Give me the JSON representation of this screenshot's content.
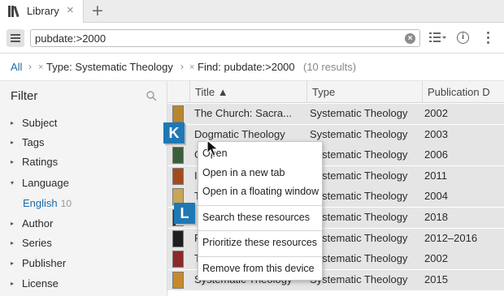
{
  "tab": {
    "label": "Library",
    "close_glyph": "×",
    "new_tab_glyph": "+"
  },
  "toolbar": {
    "search_value": "pubdate:>2000",
    "clear_icon": "clear-circle-icon",
    "view_icon": "list-view-icon",
    "info_icon": "info-icon",
    "more_icon": "more-vertical-icon"
  },
  "breadcrumb": {
    "all": "All",
    "sep": "›",
    "x": "×",
    "type_label": "Type: Systematic Theology",
    "find_label": "Find: pubdate:>2000",
    "result_count": "(10 results)"
  },
  "filter": {
    "header": "Filter",
    "items": [
      {
        "label": "Subject",
        "expanded": false
      },
      {
        "label": "Tags",
        "expanded": false
      },
      {
        "label": "Ratings",
        "expanded": false
      },
      {
        "label": "Language",
        "expanded": true
      },
      {
        "label": "Author",
        "expanded": false
      },
      {
        "label": "Series",
        "expanded": false
      },
      {
        "label": "Publisher",
        "expanded": false
      },
      {
        "label": "License",
        "expanded": false
      }
    ],
    "language_sub": {
      "label": "English",
      "count": "10"
    },
    "arrow_collapsed": "▸",
    "arrow_expanded": "▾"
  },
  "table": {
    "columns": [
      {
        "label": "Title ▲"
      },
      {
        "label": "Type"
      },
      {
        "label": "Publication D"
      }
    ],
    "rows": [
      {
        "title": "The Church: Sacra...",
        "type": "Systematic Theology",
        "date": "2002",
        "cover": "#b8862f"
      },
      {
        "title": "Dogmatic Theology",
        "type": "Systematic Theology",
        "date": "2003",
        "cover": "#7a1d1d"
      },
      {
        "title": "G",
        "type": "Systematic Theology",
        "date": "2006",
        "cover": "#3b5e3a"
      },
      {
        "title": "I",
        "type": "Systematic Theology",
        "date": "2011",
        "cover": "#a24a1e"
      },
      {
        "title": "T",
        "type": "Systematic Theology",
        "date": "2004",
        "cover": "#c9a558"
      },
      {
        "title": "",
        "type": "Systematic Theology",
        "date": "2018",
        "cover": "#2f2f2f"
      },
      {
        "title": "P",
        "type": "Systematic Theology",
        "date": "2012–2016",
        "cover": "#1e1e1e"
      },
      {
        "title": "T",
        "type": "Systematic Theology",
        "date": "2002",
        "cover": "#8a2a2a"
      },
      {
        "title": "Systematic Theology",
        "type": "Systematic Theology",
        "date": "2015",
        "cover": "#c48a2a"
      }
    ]
  },
  "context_menu": {
    "items": [
      {
        "label": "Open"
      },
      {
        "label": "Open in a new tab"
      },
      {
        "label": "Open in a floating window"
      },
      {
        "label": "Search these resources"
      },
      {
        "label": "Prioritize these resources"
      },
      {
        "label": "Remove from this device"
      }
    ]
  },
  "badges": {
    "k": "K",
    "l": "L"
  },
  "colors": {
    "accent": "#1f78b4",
    "link": "#1a6aa8",
    "row_selected": "#e5e5e5",
    "panel": "#f4f4f4"
  }
}
